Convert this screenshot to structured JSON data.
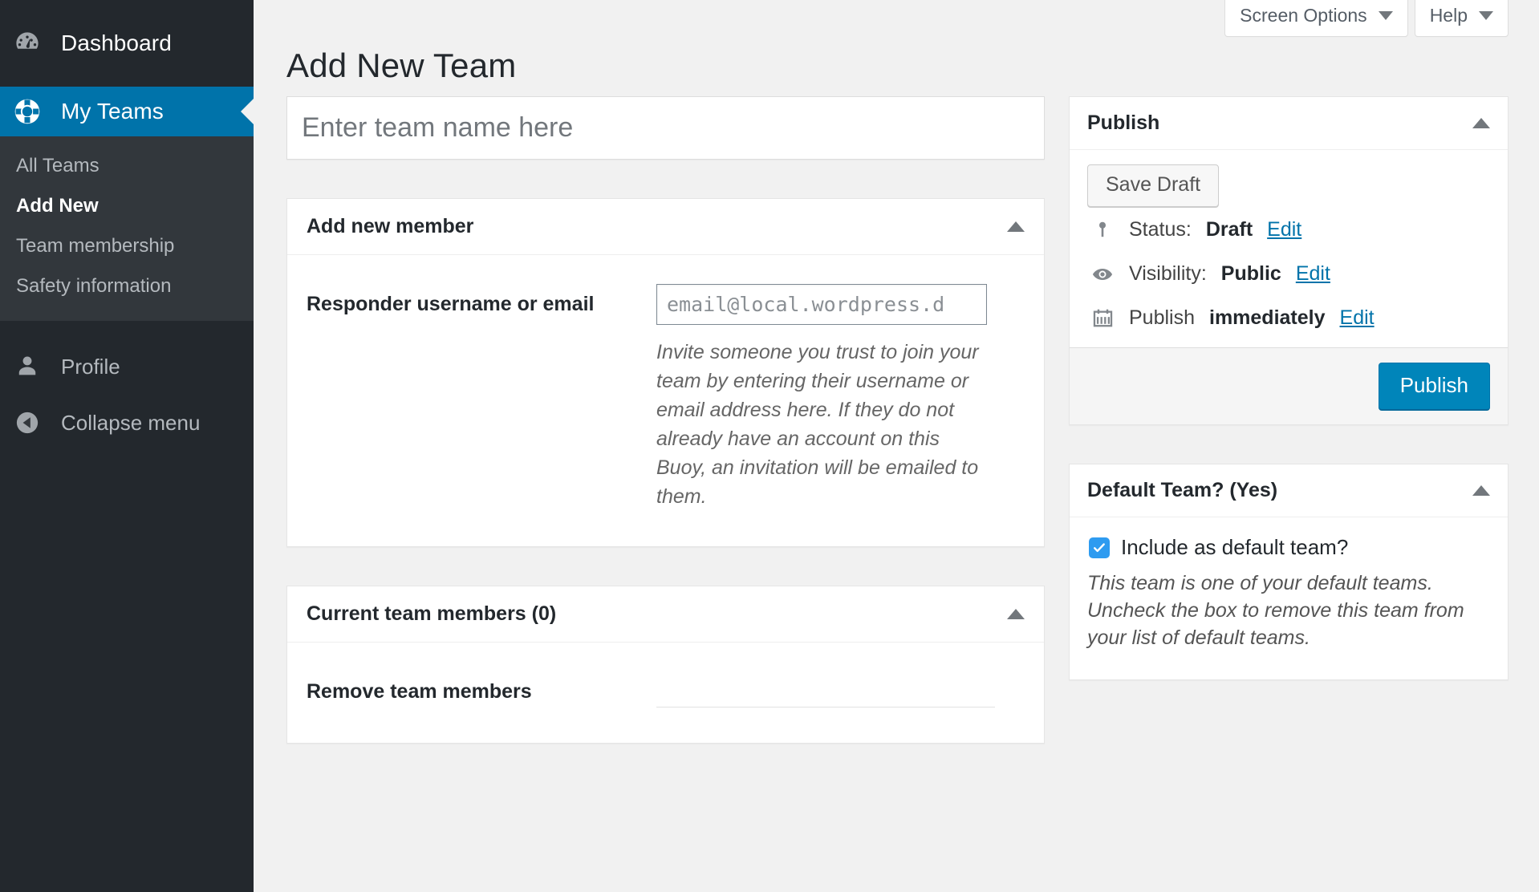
{
  "sidebar": {
    "dashboard": {
      "label": "Dashboard",
      "icon": "dashboard-gauge-icon"
    },
    "my_teams": {
      "label": "My Teams",
      "icon": "life-buoy-icon"
    },
    "submenu": [
      {
        "label": "All Teams",
        "current": false
      },
      {
        "label": "Add New",
        "current": true
      },
      {
        "label": "Team membership",
        "current": false
      },
      {
        "label": "Safety information",
        "current": false
      }
    ],
    "profile": {
      "label": "Profile",
      "icon": "user-icon"
    },
    "collapse": {
      "label": "Collapse menu",
      "icon": "collapse-arrow-icon"
    }
  },
  "screen_meta": {
    "screen_options": "Screen Options",
    "help": "Help"
  },
  "page": {
    "title": "Add New Team",
    "title_placeholder": "Enter team name here"
  },
  "add_member_box": {
    "title": "Add new member",
    "field_label": "Responder username or email",
    "field_placeholder": "email@local.wordpress.d",
    "field_value": "",
    "description": "Invite someone you trust to join your team by entering their username or email address here. If they do not already have an account on this Buoy, an invitation will be emailed to them."
  },
  "current_members_box": {
    "title": "Current team members (0)",
    "remove_label": "Remove team members"
  },
  "publish_box": {
    "title": "Publish",
    "save_draft_label": "Save Draft",
    "status_label": "Status:",
    "status_value": "Draft",
    "status_edit": "Edit",
    "visibility_label": "Visibility:",
    "visibility_value": "Public",
    "visibility_edit": "Edit",
    "publish_label": "Publish",
    "publish_value": "immediately",
    "publish_edit": "Edit",
    "publish_button": "Publish"
  },
  "default_team_box": {
    "title": "Default Team? (Yes)",
    "checkbox_label": "Include as default team?",
    "checkbox_checked": true,
    "description": "This team is one of your default teams. Uncheck the box to remove this team from your list of default teams."
  },
  "colors": {
    "sidebar_bg": "#23282d",
    "submenu_bg": "#32373c",
    "accent_blue": "#0073aa",
    "primary_button": "#0085ba",
    "link_blue": "#0073aa",
    "checkbox_blue": "#2e9bf0",
    "page_bg": "#f1f1f1"
  }
}
